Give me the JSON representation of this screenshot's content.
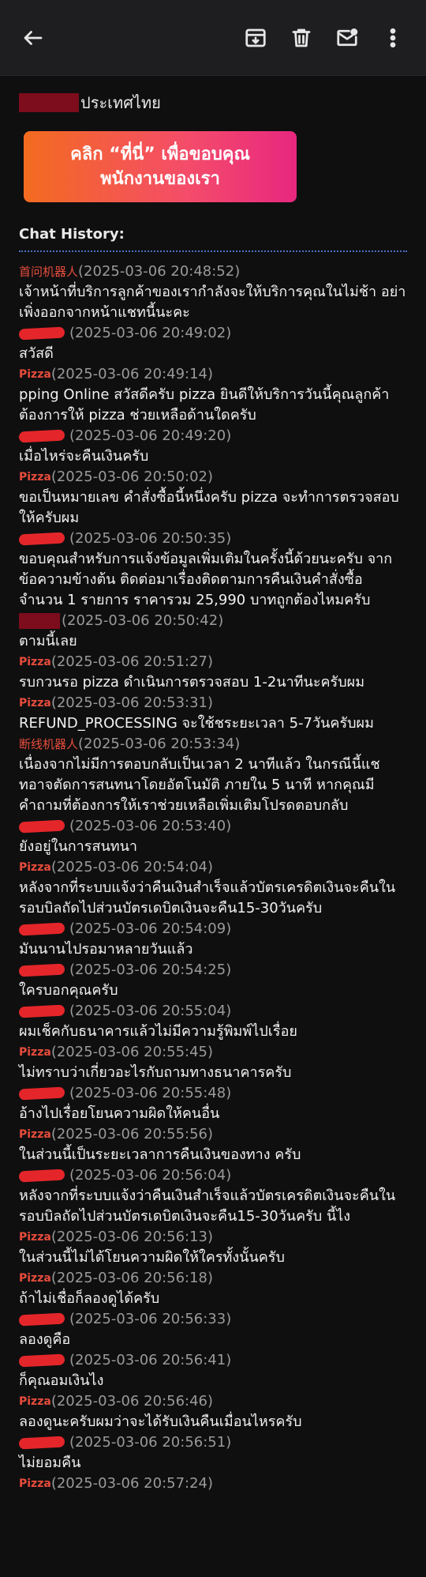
{
  "toolbar": {
    "back": "back-arrow-icon",
    "archive": "archive-icon",
    "delete": "trash-icon",
    "mark_unread": "mail-unread-icon",
    "more": "more-vert-icon"
  },
  "email": {
    "greeting_suffix": "ประเทศไทย",
    "banner_line1": "คลิก “ที่นี่” เพื่อขอบคุณ",
    "banner_line2": "พนักงานของเรา"
  },
  "chat": {
    "title": "Chat History:",
    "messages": [
      {
        "sender": "首问机器人",
        "type": "bot",
        "time": "(2025-03-06 20:48:52)",
        "text": "เจ้าหน้าที่บริการลูกค้าของเรากำลังจะให้บริการคุณในไม่ช้า อย่าเพิ่งออกจากหน้าแชทนี้นะคะ"
      },
      {
        "sender": "",
        "type": "user",
        "time": "(2025-03-06 20:49:02)",
        "text": "สวัสดี"
      },
      {
        "sender": "Pizza",
        "type": "agent",
        "time": "(2025-03-06 20:49:14)",
        "text": "pping Online สวัสดีครับ pizza ยินดีให้บริการวันนี้คุณลูกค้า ต้องการให้ pizza ช่วยเหลือด้านใดครับ"
      },
      {
        "sender": "",
        "type": "user",
        "time": "(2025-03-06 20:49:20)",
        "text": "เมื่อไหร่จะคืนเงินครับ"
      },
      {
        "sender": "Pizza",
        "type": "agent",
        "time": "(2025-03-06 20:50:02)",
        "text": "ขอเป็นหมายเลข คำสั่งซื้อนี้หนึ่งครับ pizza จะทำการตรวจสอบให้ครับผม"
      },
      {
        "sender": "",
        "type": "user",
        "time": "(2025-03-06 20:50:35)",
        "text": "ขอบคุณสำหรับการแจ้งข้อมูลเพิ่มเติมในครั้งนี้ด้วยนะครับ จากข้อความข้างต้น ติดต่อมาเรื่องติดตามการคืนเงินคำสั่งซื้อ จำนวน 1 รายการ ราคารวม 25,990 บาทถูกต้องไหมครับ"
      },
      {
        "sender": "",
        "type": "user-box",
        "time": "(2025-03-06 20:50:42)",
        "text": "ตามนี้เลย"
      },
      {
        "sender": "Pizza",
        "type": "agent",
        "time": "(2025-03-06 20:51:27)",
        "text": "รบกวนรอ pizza ดำเนินการตรวจสอบ 1-2นาทีนะครับผม"
      },
      {
        "sender": "Pizza",
        "type": "agent",
        "time": "(2025-03-06 20:53:31)",
        "text": "REFUND_PROCESSING จะใช้ชระยะเวลา 5-7วันครับผม"
      },
      {
        "sender": "断线机器人",
        "type": "bot",
        "time": "(2025-03-06 20:53:34)",
        "text": "เนื่องจากไม่มีการตอบกลับเป็นเวลา 2 นาทีแล้ว ในกรณีนี้แชทอาจตัดการสนทนาโดยอัตโนมัติ ภายใน 5 นาที หากคุณมีคำถามที่ต้องการให้เราช่วยเหลือเพิ่มเติมโปรดตอบกลับ"
      },
      {
        "sender": "",
        "type": "user",
        "time": "(2025-03-06 20:53:40)",
        "text": "ยังอยู่ในการสนทนา"
      },
      {
        "sender": "Pizza",
        "type": "agent",
        "time": "(2025-03-06 20:54:04)",
        "text": "หลังจากที่ระบบแจ้งว่าคืนเงินสำเร็จแล้วบัตรเครดิตเงินจะคืนในรอบบิลถัดไปส่วนบัตรเดบิตเงินจะคืน15-30วันครับ"
      },
      {
        "sender": "",
        "type": "user",
        "time": "(2025-03-06 20:54:09)",
        "text": "มันนานไปรอมาหลายวันแล้ว"
      },
      {
        "sender": "",
        "type": "user",
        "time": "(2025-03-06 20:54:25)",
        "text": "ใครบอกคุณครับ"
      },
      {
        "sender": "",
        "type": "user",
        "time": "(2025-03-06 20:55:04)",
        "text": "ผมเช็คกับธนาคารแล้วไม่มีความรู้พิมพ์ไปเรื่อย"
      },
      {
        "sender": "Pizza",
        "type": "agent",
        "time": "(2025-03-06 20:55:45)",
        "text": "ไม่ทราบว่าเกี่ยวอะไรกับถามทางธนาคารครับ"
      },
      {
        "sender": "",
        "type": "user",
        "time": "(2025-03-06 20:55:48)",
        "text": "อ้างไปเรื่อยโยนความผิดให้คนอื่น"
      },
      {
        "sender": "Pizza",
        "type": "agent",
        "time": "(2025-03-06 20:55:56)",
        "text": "ในส่วนนี้เป็นระยะเวลาการคืนเงินของทาง ครับ"
      },
      {
        "sender": "",
        "type": "user",
        "time": "(2025-03-06 20:56:04)",
        "text": "หลังจากที่ระบบแจ้งว่าคืนเงินสำเร็จแล้วบัตรเครดิตเงินจะคืนในรอบบิลถัดไปส่วนบัตรเดบิตเงินจะคืน15-30วันครับ นี้ไง"
      },
      {
        "sender": "Pizza",
        "type": "agent",
        "time": "(2025-03-06 20:56:13)",
        "text": "ในส่วนนี้ไม่ได้โยนความผิดให้ใครทั้งนั้นครับ"
      },
      {
        "sender": "Pizza",
        "type": "agent",
        "time": "(2025-03-06 20:56:18)",
        "text": "ถ้าไม่เชื่อก็ลองดูได้ครับ"
      },
      {
        "sender": "",
        "type": "user",
        "time": "(2025-03-06 20:56:33)",
        "text": "ลองดูคือ"
      },
      {
        "sender": "",
        "type": "user",
        "time": "(2025-03-06 20:56:41)",
        "text": "ก็คุณอมเงินไง"
      },
      {
        "sender": "Pizza",
        "type": "agent",
        "time": "(2025-03-06 20:56:46)",
        "text": "ลองดูนะครับผมว่าจะได้รับเงินคืนเมื่อนไหรครับ"
      },
      {
        "sender": "",
        "type": "user",
        "time": "(2025-03-06 20:56:51)",
        "text": "ไม่ยอมคืน"
      },
      {
        "sender": "Pizza",
        "type": "agent",
        "time": "(2025-03-06 20:57:24)",
        "text": ""
      }
    ]
  }
}
